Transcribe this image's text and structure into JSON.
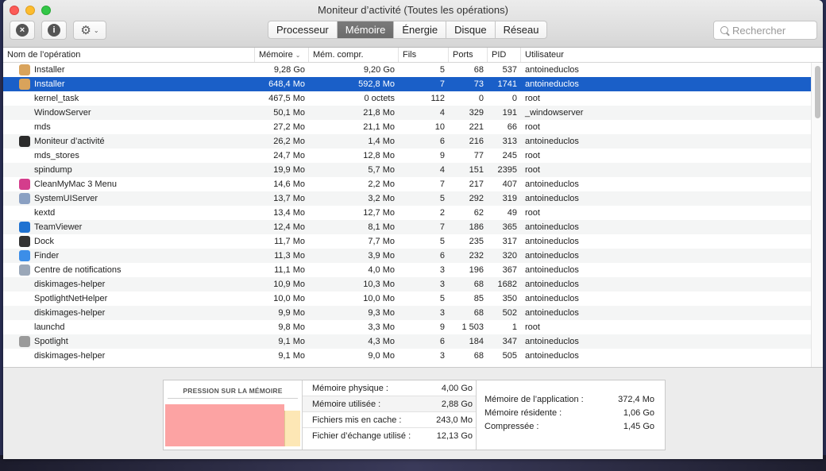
{
  "window": {
    "title": "Moniteur d’activité (Toutes les opérations)"
  },
  "toolbar": {
    "stop_symbol": "×",
    "info_symbol": "i",
    "gear_symbol": "⚙",
    "chevron_symbol": "⌄",
    "tabs": [
      {
        "label": "Processeur"
      },
      {
        "label": "Mémoire"
      },
      {
        "label": "Énergie"
      },
      {
        "label": "Disque"
      },
      {
        "label": "Réseau"
      }
    ],
    "active_tab": "Mémoire",
    "search_placeholder": "Rechercher"
  },
  "table": {
    "headers": {
      "name": "Nom de l’opération",
      "memory": "Mémoire",
      "sort_arrow": "⌄",
      "compressed": "Mém. compr.",
      "threads": "Fils",
      "ports": "Ports",
      "pid": "PID",
      "user": "Utilisateur"
    },
    "rows": [
      {
        "name": "Installer",
        "mem": "9,28 Go",
        "comp": "9,20 Go",
        "fils": "5",
        "ports": "68",
        "pid": "537",
        "user": "antoineduclos",
        "icon": "installer-icon",
        "color": "#d9a35b"
      },
      {
        "name": "Installer",
        "mem": "648,4 Mo",
        "comp": "592,8 Mo",
        "fils": "7",
        "ports": "73",
        "pid": "1741",
        "user": "antoineduclos",
        "icon": "installer-icon",
        "color": "#d9a35b"
      },
      {
        "name": "kernel_task",
        "mem": "467,5 Mo",
        "comp": "0 octets",
        "fils": "112",
        "ports": "0",
        "pid": "0",
        "user": "root",
        "icon": "",
        "color": ""
      },
      {
        "name": "WindowServer",
        "mem": "50,1 Mo",
        "comp": "21,8 Mo",
        "fils": "4",
        "ports": "329",
        "pid": "191",
        "user": "_windowserver",
        "icon": "",
        "color": ""
      },
      {
        "name": "mds",
        "mem": "27,2 Mo",
        "comp": "21,1 Mo",
        "fils": "10",
        "ports": "221",
        "pid": "66",
        "user": "root",
        "icon": "",
        "color": ""
      },
      {
        "name": "Moniteur d’activité",
        "mem": "26,2 Mo",
        "comp": "1,4 Mo",
        "fils": "6",
        "ports": "216",
        "pid": "313",
        "user": "antoineduclos",
        "icon": "activity-monitor-icon",
        "color": "#2b2b2b"
      },
      {
        "name": "mds_stores",
        "mem": "24,7 Mo",
        "comp": "12,8 Mo",
        "fils": "9",
        "ports": "77",
        "pid": "245",
        "user": "root",
        "icon": "",
        "color": ""
      },
      {
        "name": "spindump",
        "mem": "19,9 Mo",
        "comp": "5,7 Mo",
        "fils": "4",
        "ports": "151",
        "pid": "2395",
        "user": "root",
        "icon": "",
        "color": ""
      },
      {
        "name": "CleanMyMac 3 Menu",
        "mem": "14,6 Mo",
        "comp": "2,2 Mo",
        "fils": "7",
        "ports": "217",
        "pid": "407",
        "user": "antoineduclos",
        "icon": "cleanmymac-icon",
        "color": "#d43d8c"
      },
      {
        "name": "SystemUIServer",
        "mem": "13,7 Mo",
        "comp": "3,2 Mo",
        "fils": "5",
        "ports": "292",
        "pid": "319",
        "user": "antoineduclos",
        "icon": "systemuiserver-icon",
        "color": "#8aa0c2"
      },
      {
        "name": "kextd",
        "mem": "13,4 Mo",
        "comp": "12,7 Mo",
        "fils": "2",
        "ports": "62",
        "pid": "49",
        "user": "root",
        "icon": "",
        "color": ""
      },
      {
        "name": "TeamViewer",
        "mem": "12,4 Mo",
        "comp": "8,1 Mo",
        "fils": "7",
        "ports": "186",
        "pid": "365",
        "user": "antoineduclos",
        "icon": "teamviewer-icon",
        "color": "#1f72d1"
      },
      {
        "name": "Dock",
        "mem": "11,7 Mo",
        "comp": "7,7 Mo",
        "fils": "5",
        "ports": "235",
        "pid": "317",
        "user": "antoineduclos",
        "icon": "dock-icon",
        "color": "#333333"
      },
      {
        "name": "Finder",
        "mem": "11,3 Mo",
        "comp": "3,9 Mo",
        "fils": "6",
        "ports": "232",
        "pid": "320",
        "user": "antoineduclos",
        "icon": "finder-icon",
        "color": "#3c8ee8"
      },
      {
        "name": "Centre de notifications",
        "mem": "11,1 Mo",
        "comp": "4,0 Mo",
        "fils": "3",
        "ports": "196",
        "pid": "367",
        "user": "antoineduclos",
        "icon": "notification-center-icon",
        "color": "#9aa7b8"
      },
      {
        "name": "diskimages-helper",
        "mem": "10,9 Mo",
        "comp": "10,3 Mo",
        "fils": "3",
        "ports": "68",
        "pid": "1682",
        "user": "antoineduclos",
        "icon": "",
        "color": ""
      },
      {
        "name": "SpotlightNetHelper",
        "mem": "10,0 Mo",
        "comp": "10,0 Mo",
        "fils": "5",
        "ports": "85",
        "pid": "350",
        "user": "antoineduclos",
        "icon": "",
        "color": ""
      },
      {
        "name": "diskimages-helper",
        "mem": "9,9 Mo",
        "comp": "9,3 Mo",
        "fils": "3",
        "ports": "68",
        "pid": "502",
        "user": "antoineduclos",
        "icon": "",
        "color": ""
      },
      {
        "name": "launchd",
        "mem": "9,8 Mo",
        "comp": "3,3 Mo",
        "fils": "9",
        "ports": "1 503",
        "pid": "1",
        "user": "root",
        "icon": "",
        "color": ""
      },
      {
        "name": "Spotlight",
        "mem": "9,1 Mo",
        "comp": "4,3 Mo",
        "fils": "6",
        "ports": "184",
        "pid": "347",
        "user": "antoineduclos",
        "icon": "spotlight-icon",
        "color": "#9a9a9a"
      },
      {
        "name": "diskimages-helper",
        "mem": "9,1 Mo",
        "comp": "9,0 Mo",
        "fils": "3",
        "ports": "68",
        "pid": "505",
        "user": "antoineduclos",
        "icon": "",
        "color": ""
      }
    ],
    "selected_index": 1
  },
  "memory_panel": {
    "pressure_title": "PRESSION SUR LA MÉMOIRE",
    "stats": [
      {
        "label": "Mémoire physique :",
        "value": "4,00 Go"
      },
      {
        "label": "Mémoire utilisée :",
        "value": "2,88 Go"
      },
      {
        "label": "Fichiers mis en cache :",
        "value": "243,0 Mo"
      },
      {
        "label": "Fichier d’échange utilisé :",
        "value": "12,13 Go"
      }
    ],
    "app_stats": [
      {
        "label": "Mémoire de l’application :",
        "value": "372,4 Mo"
      },
      {
        "label": "Mémoire résidente :",
        "value": "1,06 Go"
      },
      {
        "label": "Compressée :",
        "value": "1,45 Go"
      }
    ]
  }
}
